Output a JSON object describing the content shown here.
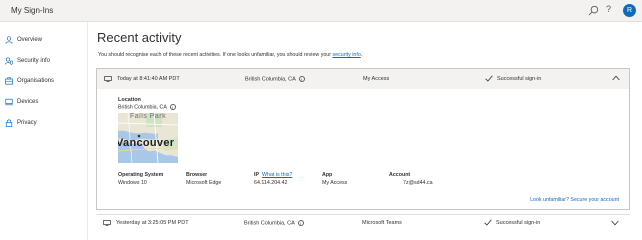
{
  "app": {
    "title": "My Sign-Ins",
    "avatar_letter": "R"
  },
  "sidebar": {
    "items": [
      {
        "label": "Overview",
        "icon": "person-icon"
      },
      {
        "label": "Security info",
        "icon": "security-info-icon"
      },
      {
        "label": "Organisations",
        "icon": "organisation-icon"
      },
      {
        "label": "Devices",
        "icon": "devices-icon"
      },
      {
        "label": "Privacy",
        "icon": "lock-icon"
      }
    ]
  },
  "main": {
    "title": "Recent activity",
    "subtitle": "You should recognise each of these recent activities. If one looks unfamiliar, you should review your",
    "subtitle_link": "security info",
    "activities": [
      {
        "time": "Today at 8:41:40 AM PDT",
        "location": "British Columbia, CA",
        "app": "My Access",
        "status": "Successful sign-in",
        "expanded": true,
        "details": {
          "location_label": "Location",
          "location_value": "British Columbia, CA",
          "map_labels": [
            "Falls Park",
            "Vancouver"
          ],
          "os_label": "Operating System",
          "os_value": "Windows 10",
          "browser_label": "Browser",
          "browser_value": "Microsoft Edge",
          "ip_label": "IP",
          "ip_link": "What is this?",
          "ip_value": "64.114.204.42",
          "app_label": "App",
          "app_value": "My Access",
          "account_label": "Account",
          "account_value": "7z@sd44.ca",
          "unfamiliar_link": "Look unfamiliar? Secure your account"
        }
      },
      {
        "time": "Yesterday at 3:25:05 PM PDT",
        "location": "British Columbia, CA",
        "app": "Microsoft Teams",
        "status": "Successful sign-in",
        "expanded": false
      }
    ]
  },
  "colors": {
    "accent": "#0f6cbd",
    "topbar": "#f3f2f1",
    "success": "#107c10"
  }
}
